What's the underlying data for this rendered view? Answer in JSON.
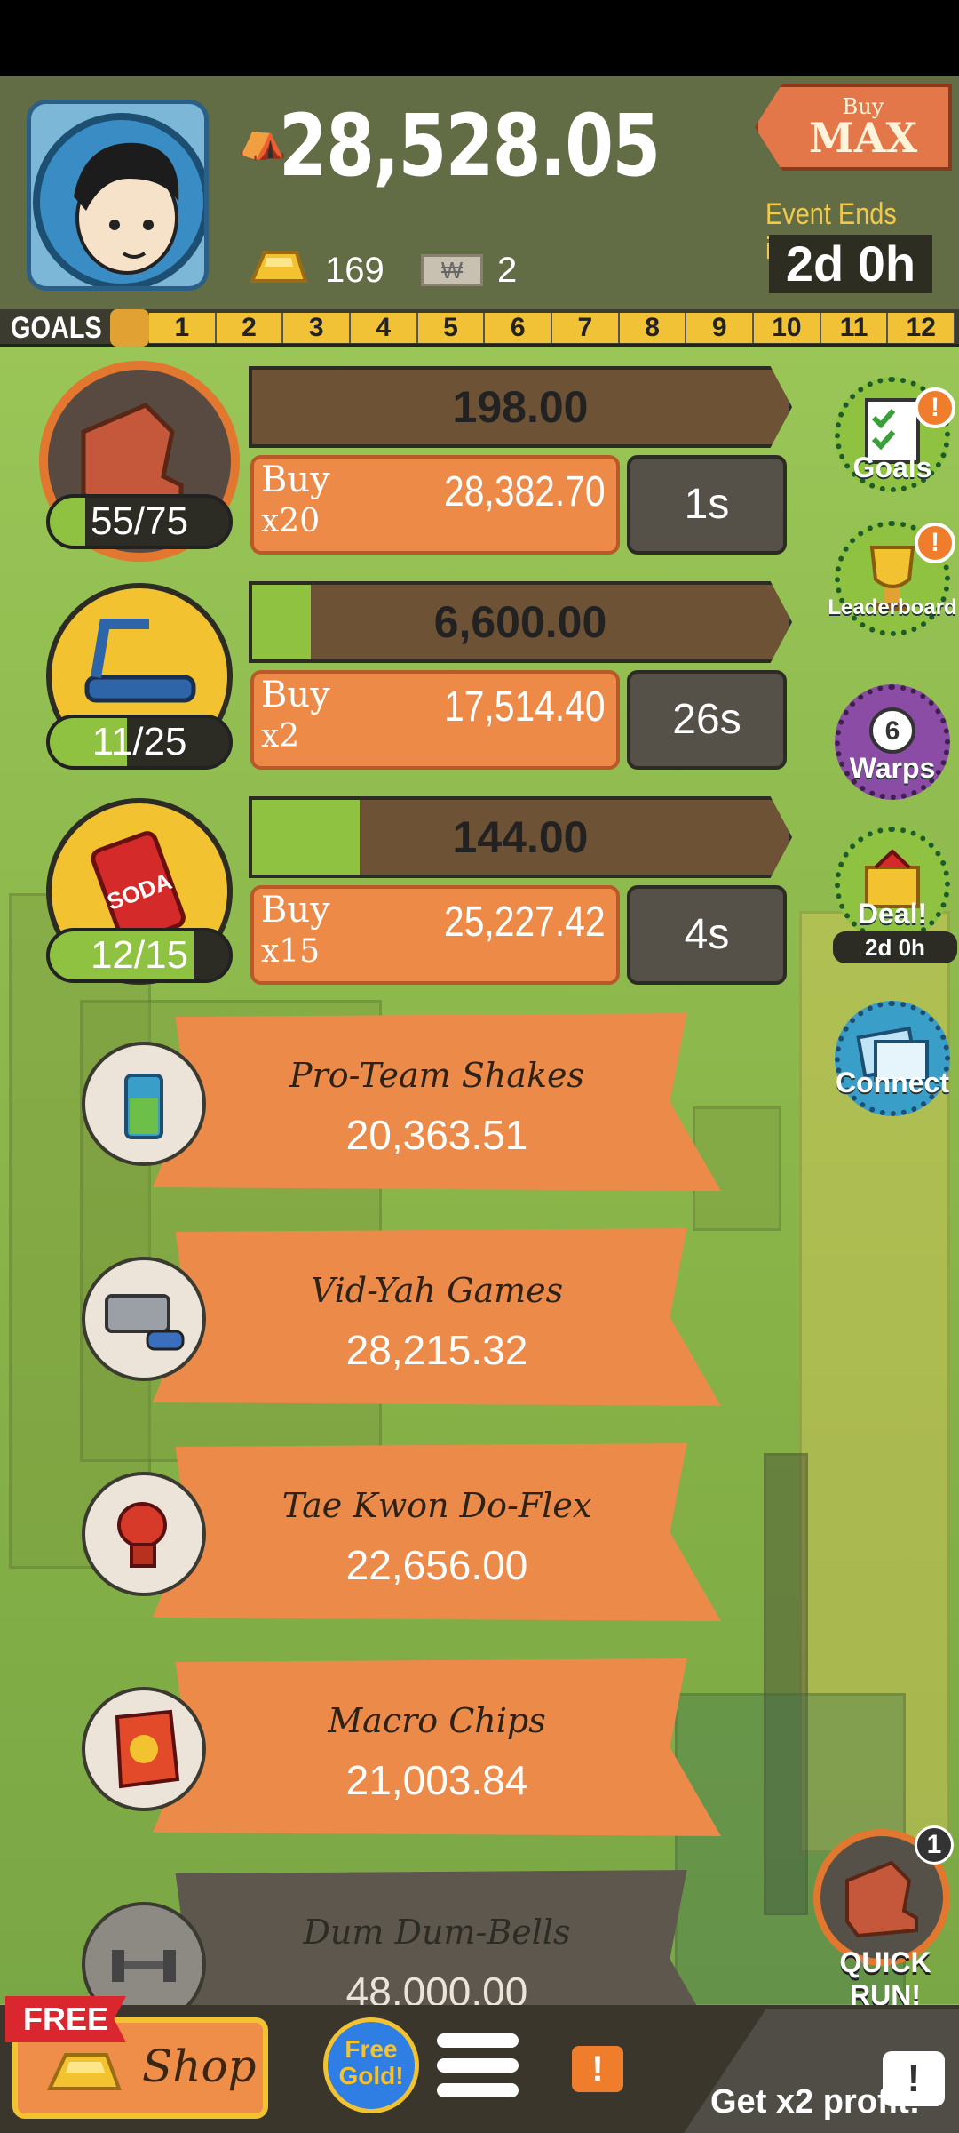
{
  "header": {
    "cash": "28,528.05",
    "gold_count": "169",
    "ticket_count": "2",
    "ticket_symbol": "₩",
    "buy_max": {
      "small": "Buy",
      "big": "MAX"
    },
    "event_label": "Event Ends in:",
    "event_time": "2d 0h"
  },
  "goals": {
    "label": "GOALS",
    "numbers": [
      "1",
      "2",
      "3",
      "4",
      "5",
      "6",
      "7",
      "8",
      "9",
      "10",
      "11",
      "12"
    ]
  },
  "businesses": [
    {
      "owned": "55/75",
      "owned_fraction": 0.2,
      "revenue": "198.00",
      "revenue_progress": 0.0,
      "buy_label": "Buy",
      "buy_mult": "x20",
      "buy_cost": "28,382.70",
      "time": "1s",
      "icon": "armchair-icon"
    },
    {
      "owned": "11/25",
      "owned_fraction": 0.43,
      "revenue": "6,600.00",
      "revenue_progress": 0.11,
      "buy_label": "Buy",
      "buy_mult": "x2",
      "buy_cost": "17,514.40",
      "time": "26s",
      "icon": "treadmill-icon"
    },
    {
      "owned": "12/15",
      "owned_fraction": 0.8,
      "revenue": "144.00",
      "revenue_progress": 0.2,
      "buy_label": "Buy",
      "buy_mult": "x15",
      "buy_cost": "25,227.42",
      "time": "4s",
      "icon": "soda-can-icon",
      "icon_text": "SODA"
    }
  ],
  "locked": [
    {
      "name": "Pro-Team Shakes",
      "price": "20,363.51",
      "icon": "shake-cup-icon"
    },
    {
      "name": "Vid-Yah Games",
      "price": "28,215.32",
      "icon": "game-console-icon"
    },
    {
      "name": "Tae Kwon Do-Flex",
      "price": "22,656.00",
      "icon": "boxing-glove-icon"
    },
    {
      "name": "Macro Chips",
      "price": "21,003.84",
      "icon": "chips-bag-icon"
    },
    {
      "name": "Dum Dum-Bells",
      "price": "48,000.00",
      "icon": "dumbbell-icon"
    }
  ],
  "side": {
    "goals": "Goals",
    "leaderboard": "Leaderboard",
    "warps": "Warps",
    "warps_count": "6",
    "deal": "Deal!",
    "deal_time": "2d 0h",
    "connect": "Connect",
    "alert": "!"
  },
  "quickrun": {
    "label": "QUICK RUN!",
    "badge": "1"
  },
  "bottom": {
    "free": "FREE",
    "shop": "Shop",
    "free_gold_1": "Free",
    "free_gold_2": "Gold!",
    "notice": "!",
    "x2": "Get x2 profit!",
    "tv": "!"
  },
  "colors": {
    "accent_orange": "#ed8a48",
    "progress_green": "#8ec240",
    "gold": "#f2c230",
    "header_bg": "#626c45"
  }
}
